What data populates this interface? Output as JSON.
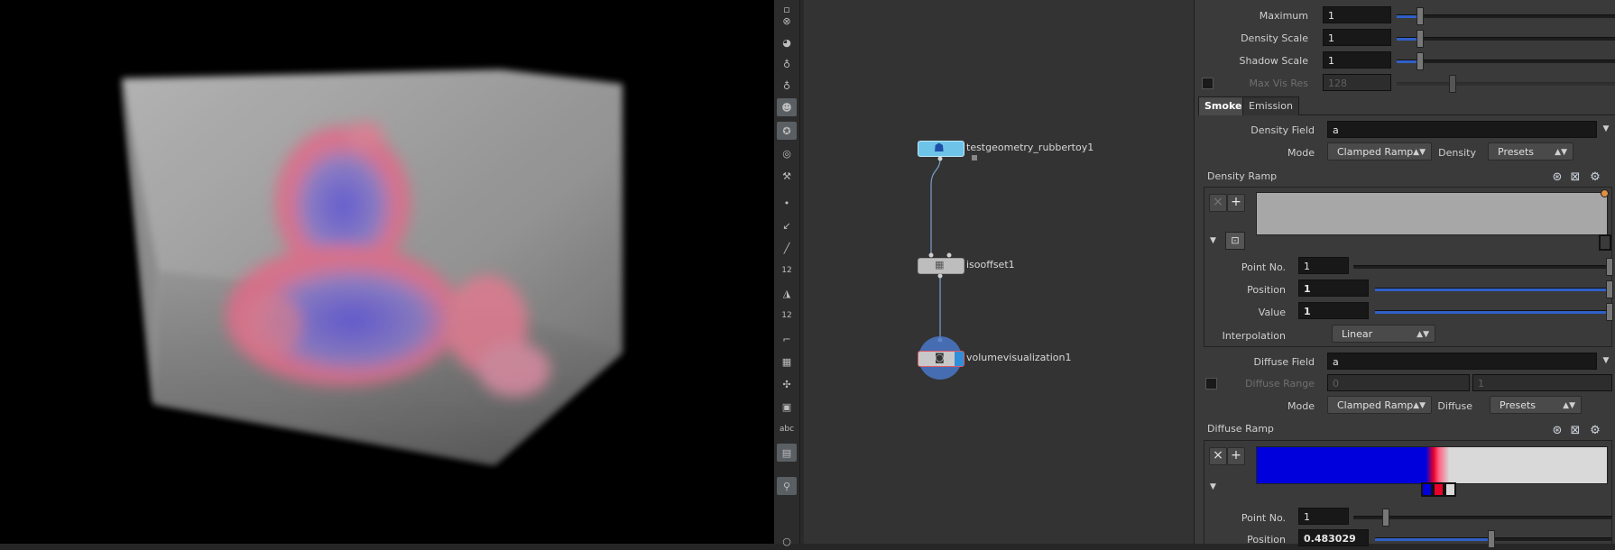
{
  "colors": {
    "accent": "#3060c8",
    "viewport_bg": "#000000",
    "network_bg": "#333333",
    "params_bg": "#3a3a3a",
    "ramp_blue": "#0000dd",
    "ramp_red": "#e8002a"
  },
  "shelf": {
    "tools": [
      "primitive-icon",
      "sphere-icon",
      "light-icon",
      "point-light-icon",
      "camera-icon",
      "render-icon",
      "view-icon",
      "paint-icon",
      "dot-icon",
      "brush-icon",
      "pen-icon",
      "number-icon",
      "sculpt-icon",
      "number-icon",
      "bracket-icon",
      "grid-icon",
      "transform-icon",
      "box-icon",
      "text-icon",
      "image-icon",
      "pin-icon"
    ],
    "abc_label": "abc",
    "num_label": "12"
  },
  "network": {
    "nodes": [
      {
        "name": "testgeometry_rubbertoy1"
      },
      {
        "name": "isooffset1"
      },
      {
        "name": "volumevisualization1"
      }
    ]
  },
  "params": {
    "top": [
      {
        "label": "Maximum",
        "value": "1"
      },
      {
        "label": "Density Scale",
        "value": "1"
      },
      {
        "label": "Shadow Scale",
        "value": "1"
      },
      {
        "label": "Max Vis Res",
        "value": "128"
      }
    ],
    "tabs": [
      "Smoke",
      "Emission"
    ],
    "density": {
      "field_label": "Density Field",
      "field_value": "a",
      "mode_label": "Mode",
      "mode_value": "Clamped Ramp",
      "preset_label": "Density",
      "preset_value": "Presets",
      "ramp_label": "Density Ramp",
      "point_no_label": "Point No.",
      "point_no_value": "1",
      "position_label": "Position",
      "position_value": "1",
      "value_label": "Value",
      "value_value": "1",
      "interp_label": "Interpolation",
      "interp_value": "Linear"
    },
    "diffuse": {
      "field_label": "Diffuse Field",
      "field_value": "a",
      "range_label": "Diffuse Range",
      "range_min": "0",
      "range_max": "1",
      "mode_label": "Mode",
      "mode_value": "Clamped Ramp",
      "preset_label": "Diffuse",
      "preset_value": "Presets",
      "ramp_label": "Diffuse Ramp",
      "point_no_label": "Point No.",
      "point_no_value": "1",
      "position_label": "Position",
      "position_value": "0.483029"
    },
    "ramp_buttons": {
      "remove": "×",
      "add": "+"
    }
  }
}
